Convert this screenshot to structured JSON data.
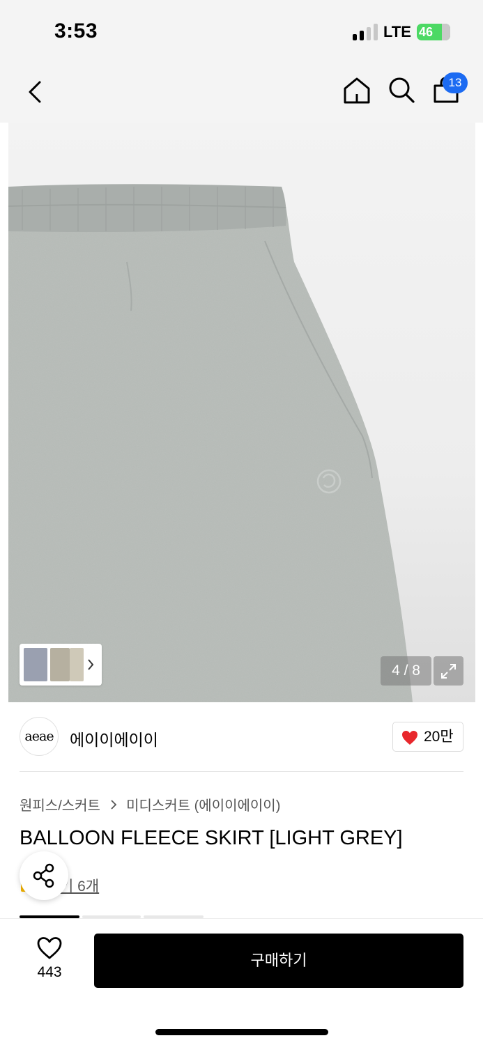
{
  "status_bar": {
    "time": "3:53",
    "network": "LTE",
    "battery": "46"
  },
  "nav": {
    "back_icon": "chevron-left-icon",
    "home_icon": "home-icon",
    "search_icon": "search-icon",
    "cart_icon": "shopping-bag-icon",
    "cart_count": "13"
  },
  "gallery": {
    "counter": "4 / 8",
    "expand_icon": "expand-icon",
    "thumbnails_chevron": "chevron-right-icon",
    "fabric_color": "#b3b8b4"
  },
  "brand": {
    "logo_text": "aeae",
    "name": "에이이에이이",
    "likes": "20만"
  },
  "product": {
    "category": "원피스/스커트",
    "subcategory": "미디스커트 (에이이에이이)",
    "title": "BALLOON FLEECE SKIRT [LIGHT GREY]",
    "reviews_visible": "기 6개"
  },
  "bottom_bar": {
    "wishlist_count": "443",
    "buy_label": "구매하기"
  },
  "colors": {
    "accent_blue": "#1c6bf2",
    "heart_red": "#e8272c",
    "buy_button": "#000000"
  }
}
